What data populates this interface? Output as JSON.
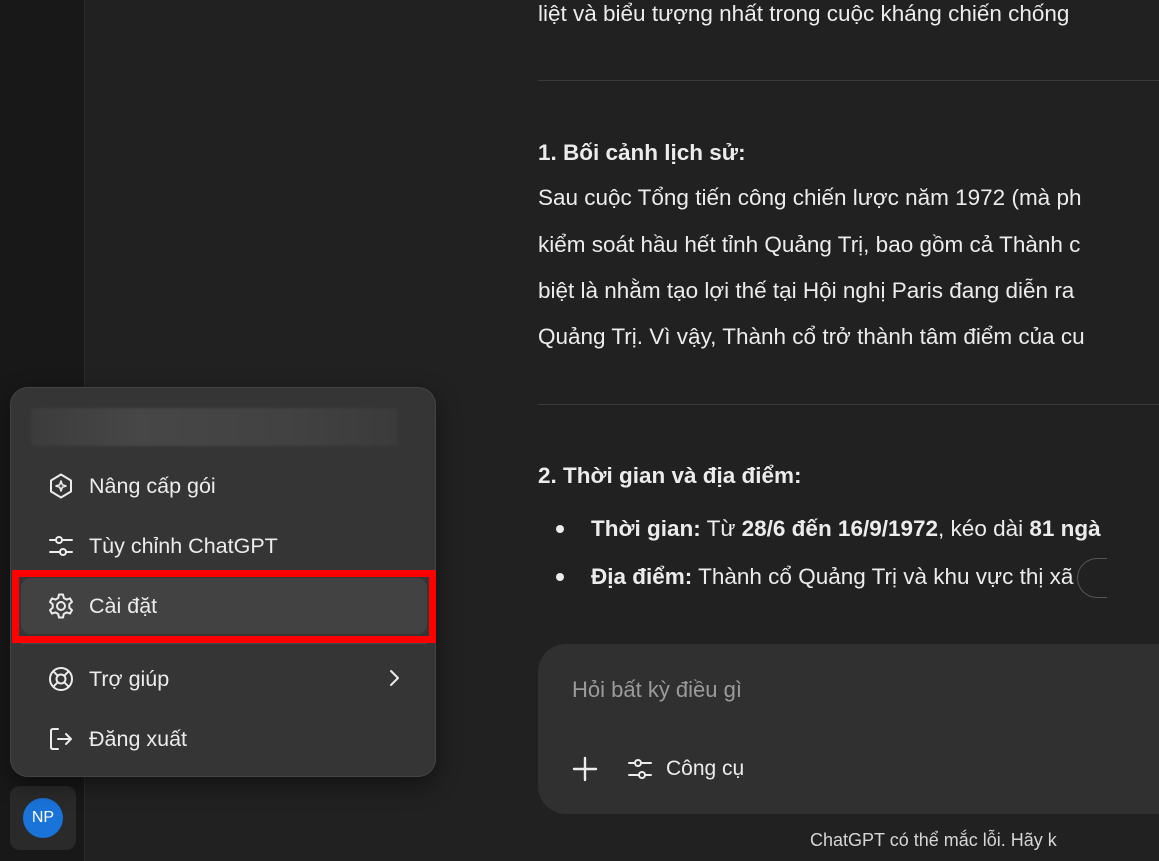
{
  "user": {
    "initials": "NP"
  },
  "conversation": {
    "line0": "liệt và biểu tượng nhất trong cuộc kháng chiến chống",
    "section1": {
      "heading": "1. Bối cảnh lịch sử:",
      "lines": [
        "Sau cuộc Tổng tiến công chiến lược năm 1972 (mà ph",
        "kiểm soát hầu hết tỉnh Quảng Trị, bao gồm cả Thành c",
        "biệt là nhằm tạo lợi thế tại Hội nghị Paris đang diễn ra",
        "Quảng Trị. Vì vậy, Thành cổ trở thành tâm điểm của cu"
      ]
    },
    "section2": {
      "heading": "2. Thời gian và địa điểm:",
      "bullet1": {
        "label": "Thời gian:",
        "t1": " Từ ",
        "bold1": "28/6 đến 16/9/1972",
        "t2": ", kéo dài ",
        "bold2": "81 ngà"
      },
      "bullet2": {
        "label": "Địa điểm:",
        "text": " Thành cổ Quảng Trị và khu vực thị xã"
      }
    }
  },
  "menu": {
    "items": [
      {
        "label": "Nâng cấp gói",
        "icon": "upgrade-icon"
      },
      {
        "label": "Tùy chỉnh ChatGPT",
        "icon": "sliders-icon"
      },
      {
        "label": "Cài đặt",
        "icon": "gear-icon"
      },
      {
        "label": "Trợ giúp",
        "icon": "lifebuoy-icon"
      },
      {
        "label": "Đăng xuất",
        "icon": "logout-icon"
      }
    ]
  },
  "composer": {
    "placeholder": "Hỏi bất kỳ điều gì",
    "tools_label": "Công cụ"
  },
  "footer": {
    "note": "ChatGPT có thể mắc lỗi. Hãy k"
  },
  "colors": {
    "highlight": "#ff0000",
    "avatar": "#1a73d9"
  }
}
